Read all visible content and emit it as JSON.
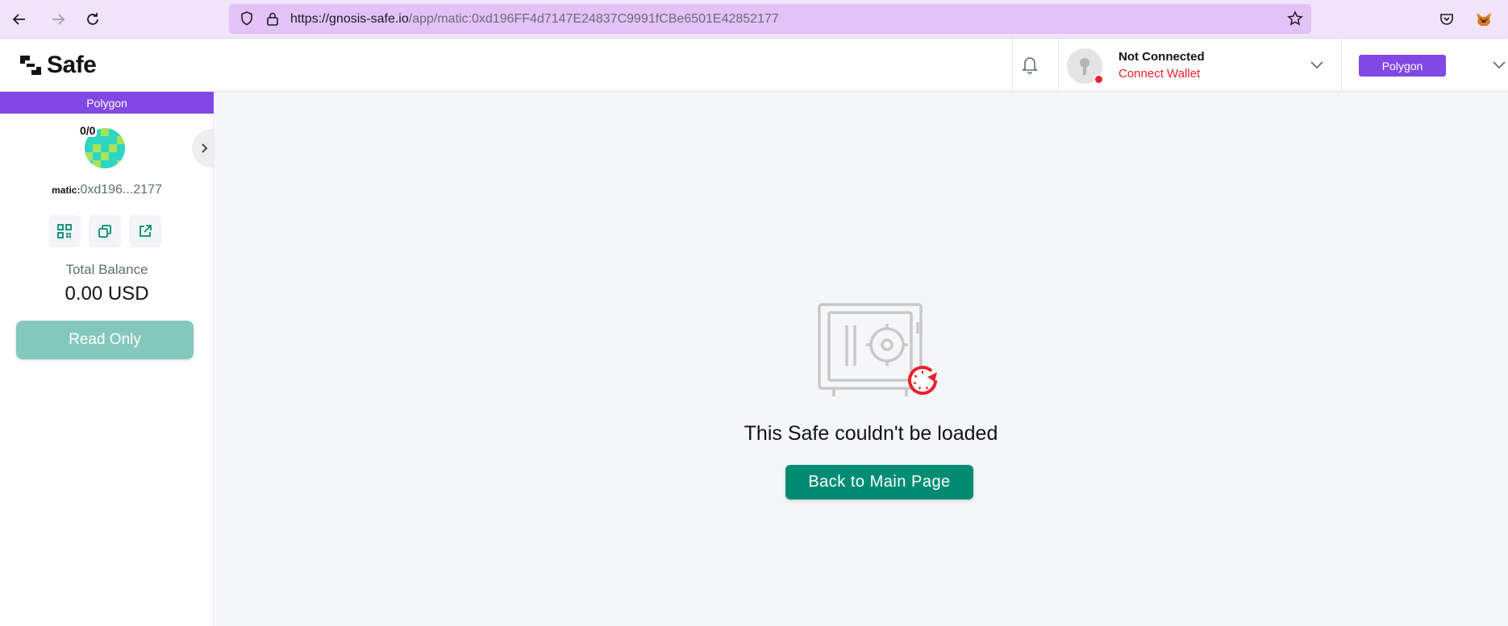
{
  "browser": {
    "url_host": "https://gnosis-safe.io",
    "url_path": "/app/matic:0xd196FF4d7147E24837C9991fCBe6501E42852177"
  },
  "header": {
    "logo_text": "Safe",
    "wallet_status": "Not Connected",
    "wallet_action": "Connect Wallet",
    "network": "Polygon"
  },
  "sidebar": {
    "network_band": "Polygon",
    "threshold": "0/0",
    "address_prefix": "matic:",
    "address_short": "0xd196...2177",
    "balance_label": "Total Balance",
    "balance_value": "0.00 USD",
    "read_only_label": "Read Only"
  },
  "main": {
    "error_title": "This Safe couldn't be loaded",
    "back_button": "Back to Main Page"
  },
  "colors": {
    "accent_green": "#008c73",
    "network_purple": "#8248e5",
    "error_red": "#e8222b"
  }
}
